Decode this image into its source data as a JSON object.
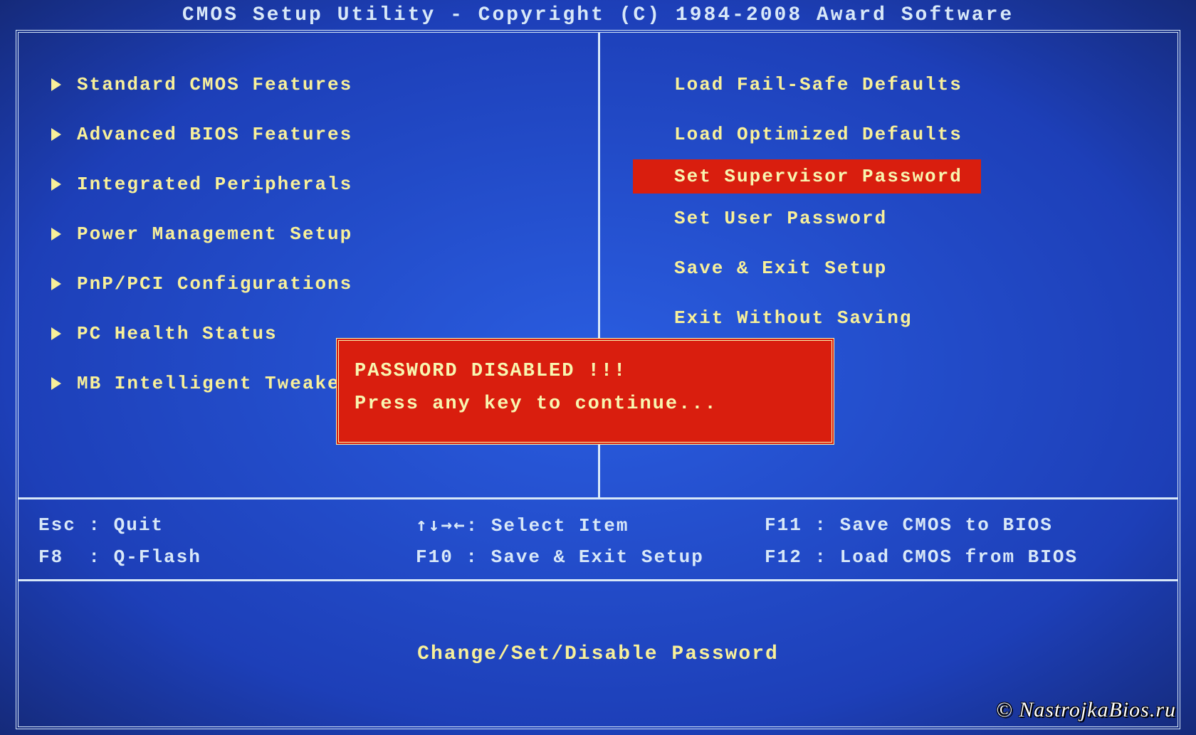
{
  "title": "CMOS Setup Utility - Copyright (C) 1984-2008 Award Software",
  "menu": {
    "left": [
      {
        "label": "Standard CMOS Features",
        "arrow": true
      },
      {
        "label": "Advanced BIOS Features",
        "arrow": true
      },
      {
        "label": "Integrated Peripherals",
        "arrow": true
      },
      {
        "label": "Power Management Setup",
        "arrow": true
      },
      {
        "label": "PnP/PCI Configurations",
        "arrow": true
      },
      {
        "label": "PC Health Status",
        "arrow": true
      },
      {
        "label": "MB Intelligent Tweaker(M.I.T.)",
        "arrow": true
      }
    ],
    "right": [
      {
        "label": "Load Fail-Safe Defaults",
        "arrow": false
      },
      {
        "label": "Load Optimized Defaults",
        "arrow": false
      },
      {
        "label": "Set Supervisor Password",
        "arrow": false,
        "selected": true
      },
      {
        "label": "Set User Password",
        "arrow": false
      },
      {
        "label": "Save & Exit Setup",
        "arrow": false
      },
      {
        "label": "Exit Without Saving",
        "arrow": false
      }
    ]
  },
  "help": {
    "r1c1": "Esc : Quit",
    "r1c2_pre": "↑↓→←",
    "r1c2_post": ": Select Item",
    "r1c3": "F11 : Save CMOS to BIOS",
    "r2c1": "F8  : Q-Flash",
    "r2c2": "F10 : Save & Exit Setup",
    "r2c3": "F12 : Load CMOS from BIOS"
  },
  "hint": "Change/Set/Disable Password",
  "dialog": {
    "line1": "PASSWORD DISABLED !!!",
    "line2": "Press any key to continue..."
  },
  "watermark": "© NastrojkaBios.ru"
}
